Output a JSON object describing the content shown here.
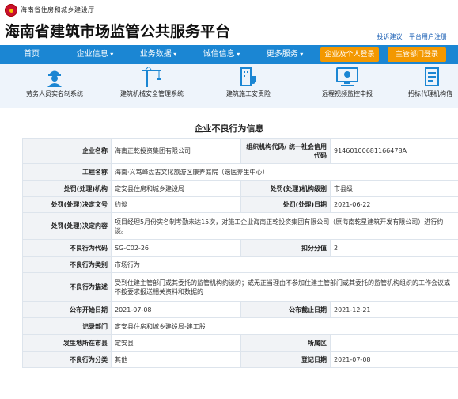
{
  "header": {
    "department": "海南省住房和城乡建设厅",
    "site_title": "海南省建筑市场监管公共服务平台",
    "links": [
      "投诉建议",
      "平台用户注册"
    ]
  },
  "nav": {
    "items": [
      "首页",
      "企业信息",
      "业务数据",
      "诚信信息",
      "更多服务"
    ],
    "buttons": [
      "企业及个人登录",
      "主管部门登录"
    ]
  },
  "systems": [
    {
      "label": "劳务人员实名制系统",
      "icon": "worker-icon"
    },
    {
      "label": "建筑机械安全管理系统",
      "icon": "crane-icon"
    },
    {
      "label": "建筑施工安责险",
      "icon": "building-shield-icon"
    },
    {
      "label": "远程视频监控申报",
      "icon": "monitor-icon"
    },
    {
      "label": "招标代理机构信",
      "icon": "document-icon"
    }
  ],
  "page_title": "企业不良行为信息",
  "record": {
    "rows": [
      {
        "k1": "企业名称",
        "v1": "海南正乾投资集团有限公司",
        "k2": "组织机构代码/ 统一社会信用代码",
        "v2": "91460100681166478A"
      },
      {
        "k1": "工程名称",
        "v1": "海南·义笃峰盘古文化旅游区康养庭院（谐医养生中心）"
      },
      {
        "k1": "处罚(处理)机构",
        "v1": "定安县住房和城乡建设局",
        "k2": "处罚(处理)机构级别",
        "v2": "市县级"
      },
      {
        "k1": "处罚(处理)决定文号",
        "v1": "约谈",
        "k2": "处罚(处理)日期",
        "v2": "2021-06-22"
      },
      {
        "k1": "处罚(处理)决定内容",
        "v1": "项目经理5月份实名制考勤未达15次，对施工企业海南正乾投资集团有限公司（原海南乾星建筑开发有限公司）进行约谈。"
      },
      {
        "k1": "不良行为代码",
        "v1": "SG-C02-26",
        "k2": "扣分分值",
        "v2": "2"
      },
      {
        "k1": "不良行为类别",
        "v1": "市场行为"
      },
      {
        "k1": "不良行为描述",
        "v1": "受到住建主管部门或其委托的监管机构约谈的；或无正当理由不参加住建主管部门或其委托的监管机构组织的工作会议或不按要求报送相关资料和数据的"
      },
      {
        "k1": "公布开始日期",
        "v1": "2021-07-08",
        "k2": "公布截止日期",
        "v2": "2021-12-21"
      },
      {
        "k1": "记录部门",
        "v1": "定安县住房和城乡建设局-建工股"
      },
      {
        "k1": "发生地所在市县",
        "v1": "定安县",
        "k2": "所属区",
        "v2": ""
      },
      {
        "k1": "不良行为分类",
        "v1": "其他",
        "k2": "登记日期",
        "v2": "2021-07-08"
      }
    ]
  }
}
